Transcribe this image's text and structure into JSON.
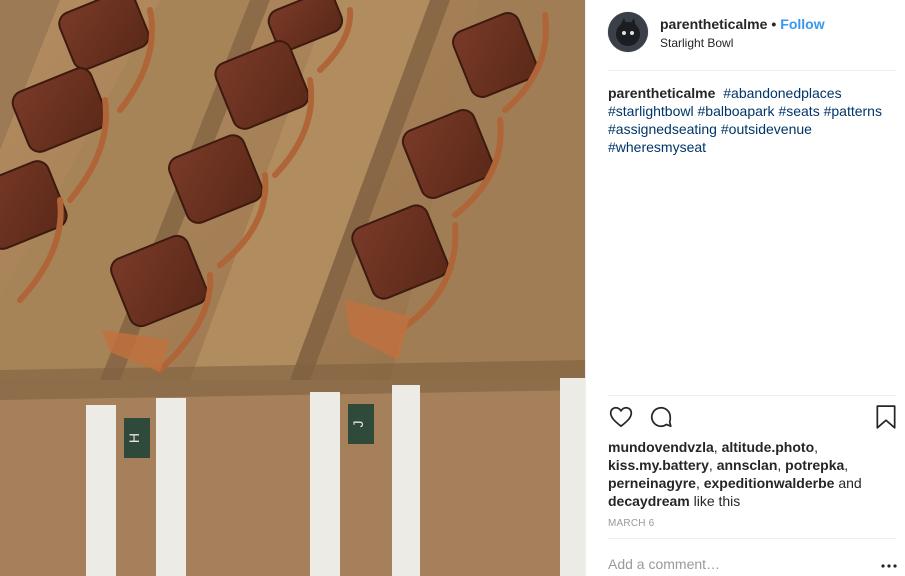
{
  "post": {
    "username": "parentheticalme",
    "separator": "•",
    "follow_label": "Follow",
    "location": "Starlight Bowl"
  },
  "caption": {
    "username": "parentheticalme",
    "hashtags": [
      "#abandonedplaces",
      "#starlightbowl",
      "#balboapark",
      "#seats",
      "#patterns",
      "#assignedseating",
      "#outsidevenue",
      "#wheresmyseat"
    ]
  },
  "likes": {
    "users": [
      "mundovendvzla",
      "altitude.photo",
      "kiss.my.battery",
      "annsclan",
      "potrepka",
      "perneinagyre",
      "expeditionwalderbe",
      "decaydream"
    ],
    "connector_and": "and",
    "suffix": "like this"
  },
  "date": "MARCH 6",
  "comment": {
    "placeholder": "Add a comment…"
  },
  "photo": {
    "row_markers": [
      "H",
      "J"
    ]
  },
  "icons": {
    "like": "heart-icon",
    "comment": "comment-bubble-icon",
    "save": "bookmark-icon",
    "more": "more-options-icon"
  },
  "colors": {
    "link": "#3897f0",
    "hashtag": "#003569",
    "text": "#262626",
    "muted": "#999999"
  }
}
